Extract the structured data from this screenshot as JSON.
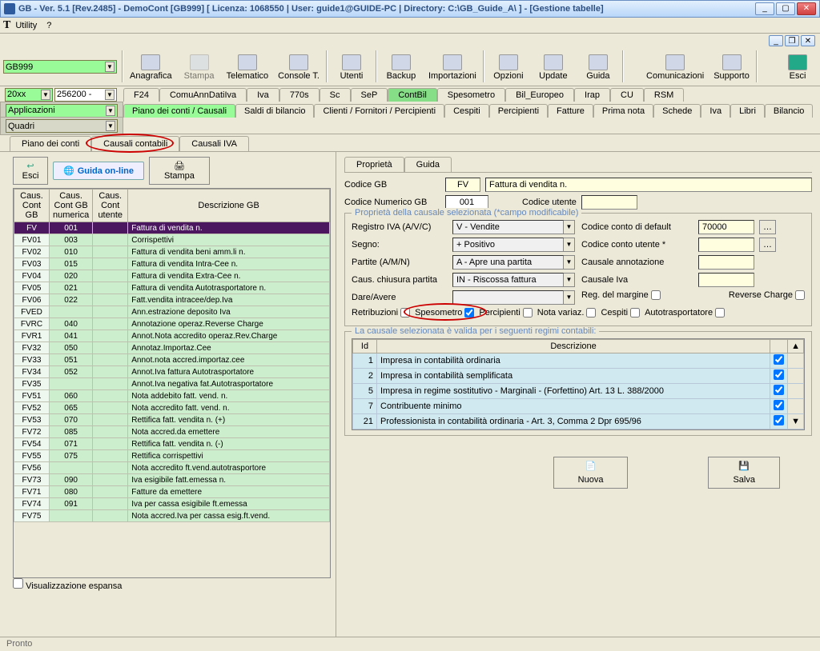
{
  "window": {
    "title": "GB - Ver. 5.1 [Rev.2485] -  DemoCont  [GB999]       [ Licenza: 1068550  | User: guide1@GUIDE-PC | Directory: C:\\GB_Guide_A\\ ] - [Gestione tabelle]"
  },
  "menubar": {
    "utility": "Utility",
    "help": "?"
  },
  "combos": {
    "ditta": "GB999",
    "anno": "20xx",
    "code": "256200 -",
    "applicazioni": "Applicazioni",
    "quadri": "Quadri"
  },
  "toolbar": {
    "anagrafica": "Anagrafica",
    "stampa": "Stampa",
    "telematico": "Telematico",
    "console": "Console T.",
    "utenti": "Utenti",
    "backup": "Backup",
    "importazioni": "Importazioni",
    "opzioni": "Opzioni",
    "update": "Update",
    "guida": "Guida",
    "comunicazioni": "Comunicazioni",
    "supporto": "Supporto",
    "esci": "Esci"
  },
  "primary_tabs": [
    "F24",
    "ComuAnnDatiIva",
    "Iva",
    "770s",
    "Sc",
    "SeP",
    "ContBil",
    "Spesometro",
    "Bil_Europeo",
    "Irap",
    "CU",
    "RSM"
  ],
  "primary_tabs_active": 6,
  "secondary_tabs": [
    "Piano dei conti / Causali",
    "Saldi di bilancio",
    "Clienti / Fornitori / Percipienti",
    "Cespiti",
    "Percipienti",
    "Fatture",
    "Prima nota",
    "Schede",
    "Iva",
    "Libri",
    "Bilancio"
  ],
  "secondary_tabs_active": 0,
  "subtabs": [
    "Piano dei conti",
    "Causali contabili",
    "Causali IVA"
  ],
  "subtabs_active": 1,
  "left": {
    "esci": "Esci",
    "guida": "Guida on-line",
    "stampa": "Stampa",
    "viz_espansa": "Visualizzazione espansa",
    "headers": {
      "h1": "Caus. Cont GB",
      "h2": "Caus. Cont GB numerica",
      "h3": "Caus. Cont utente",
      "h4": "Descrizione GB"
    },
    "rows": [
      {
        "c": "FV",
        "n": "001",
        "d": "Fattura di vendita n.",
        "sel": true
      },
      {
        "c": "FV01",
        "n": "003",
        "d": "Corrispettivi"
      },
      {
        "c": "FV02",
        "n": "010",
        "d": "Fattura di vendita beni amm.li n."
      },
      {
        "c": "FV03",
        "n": "015",
        "d": "Fattura di vendita Intra-Cee n."
      },
      {
        "c": "FV04",
        "n": "020",
        "d": "Fattura di vendita Extra-Cee n."
      },
      {
        "c": "FV05",
        "n": "021",
        "d": "Fattura di vendita Autotrasportatore n."
      },
      {
        "c": "FV06",
        "n": "022",
        "d": "Fatt.vendita intracee/dep.Iva"
      },
      {
        "c": "FVED",
        "n": "",
        "d": "Ann.estrazione deposito Iva"
      },
      {
        "c": "FVRC",
        "n": "040",
        "d": "Annotazione operaz.Reverse Charge"
      },
      {
        "c": "FVR1",
        "n": "041",
        "d": "Annot.Nota accredito operaz.Rev.Charge"
      },
      {
        "c": "FV32",
        "n": "050",
        "d": "Annotaz.Importaz.Cee"
      },
      {
        "c": "FV33",
        "n": "051",
        "d": "Annot.nota accred.importaz.cee"
      },
      {
        "c": "FV34",
        "n": "052",
        "d": "Annot.Iva fattura Autotrasportatore"
      },
      {
        "c": "FV35",
        "n": "",
        "d": "Annot.Iva negativa fat.Autotrasportatore"
      },
      {
        "c": "FV51",
        "n": "060",
        "d": "Nota addebito fatt. vend. n."
      },
      {
        "c": "FV52",
        "n": "065",
        "d": "Nota accredito fatt. vend. n."
      },
      {
        "c": "FV53",
        "n": "070",
        "d": "Rettifica fatt. vendita n. (+)"
      },
      {
        "c": "FV72",
        "n": "085",
        "d": "Nota accred.da emettere"
      },
      {
        "c": "FV54",
        "n": "071",
        "d": "Rettifica fatt. vendita n. (-)"
      },
      {
        "c": "FV55",
        "n": "075",
        "d": "Rettifica corrispettivi"
      },
      {
        "c": "FV56",
        "n": "",
        "d": "Nota accredito ft.vend.autotrasportore"
      },
      {
        "c": "FV73",
        "n": "090",
        "d": "Iva esigibile fatt.emessa n."
      },
      {
        "c": "FV71",
        "n": "080",
        "d": "Fatture da emettere"
      },
      {
        "c": "FV74",
        "n": "091",
        "d": "Iva per cassa esigibile ft.emessa"
      },
      {
        "c": "FV75",
        "n": "",
        "d": "Nota accred.Iva per cassa esig.ft.vend."
      }
    ]
  },
  "right": {
    "tabs": {
      "proprieta": "Proprietà",
      "guida": "Guida"
    },
    "codice_gb_lbl": "Codice GB",
    "codice_gb": "FV",
    "desc": "Fattura di vendita n.",
    "codice_num_lbl": "Codice Numerico GB",
    "codice_num": "001",
    "codice_utente_lbl": "Codice utente",
    "fieldset_title": "Proprietà della causale selezionata (*campo modificabile)",
    "registro_lbl": "Registro IVA (A/V/C)",
    "registro": "V - Vendite",
    "segno_lbl": "Segno:",
    "segno": "+ Positivo",
    "partite_lbl": "Partite (A/M/N)",
    "partite": "A - Apre una partita",
    "chiusura_lbl": "Caus. chiusura partita",
    "chiusura": "IN - Riscossa fattura",
    "dareavere_lbl": "Dare/Avere",
    "conto_def_lbl": "Codice conto di default",
    "conto_def": "70000",
    "conto_ut_lbl": "Codice conto utente *",
    "annot_lbl": "Causale annotazione",
    "iva_lbl": "Causale Iva",
    "regmargine": "Reg. del margine",
    "reverse": "Reverse Charge",
    "retrib": "Retribuzioni",
    "spesometro": "Spesometro",
    "percip": "Percipienti",
    "notavar": "Nota variaz.",
    "cespiti": "Cespiti",
    "autotras": "Autotrasportatore",
    "regimes_title": "La causale selezionata è valida per i seguenti regimi contabili:",
    "regimes_h_id": "Id",
    "regimes_h_desc": "Descrizione",
    "regimes": [
      {
        "id": "1",
        "d": "Impresa  in contabilità ordinaria",
        "chk": true
      },
      {
        "id": "2",
        "d": "Impresa  in contabilità semplificata",
        "chk": true
      },
      {
        "id": "5",
        "d": "Impresa in regime sostitutivo - Marginali - (Forfettino) Art. 13 L. 388/2000",
        "chk": true
      },
      {
        "id": "7",
        "d": "Contribuente minimo",
        "chk": true
      },
      {
        "id": "21",
        "d": "Professionista in contabilità ordinaria - Art. 3, Comma 2 Dpr 695/96",
        "chk": true
      }
    ],
    "nuova": "Nuova",
    "salva": "Salva"
  },
  "status": "Pronto"
}
